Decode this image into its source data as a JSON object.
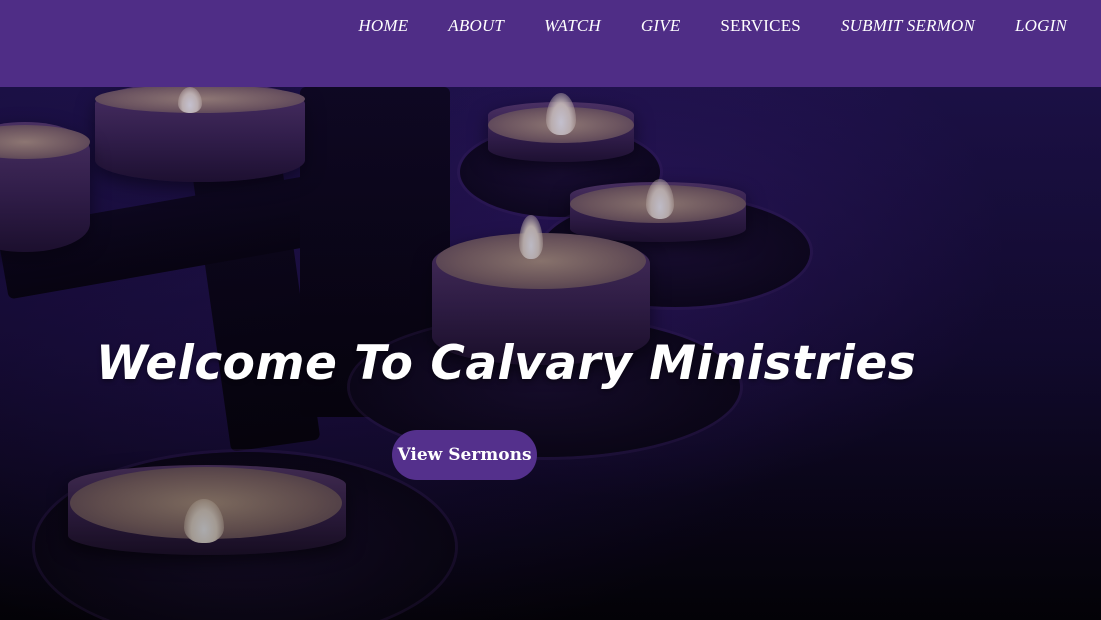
{
  "colors": {
    "header_bg": "#4f2d86",
    "button_bg": "#54308c",
    "text": "#ffffff"
  },
  "nav": {
    "items": [
      {
        "label": "HOME"
      },
      {
        "label": "ABOUT"
      },
      {
        "label": "WATCH"
      },
      {
        "label": "GIVE"
      },
      {
        "label": "SERVICES"
      },
      {
        "label": "SUBMIT SERMON"
      },
      {
        "label": "LOGIN"
      }
    ]
  },
  "hero": {
    "title": "Welcome To Calvary Ministries",
    "button_label": "View Sermons",
    "background_image": "candles-image"
  }
}
